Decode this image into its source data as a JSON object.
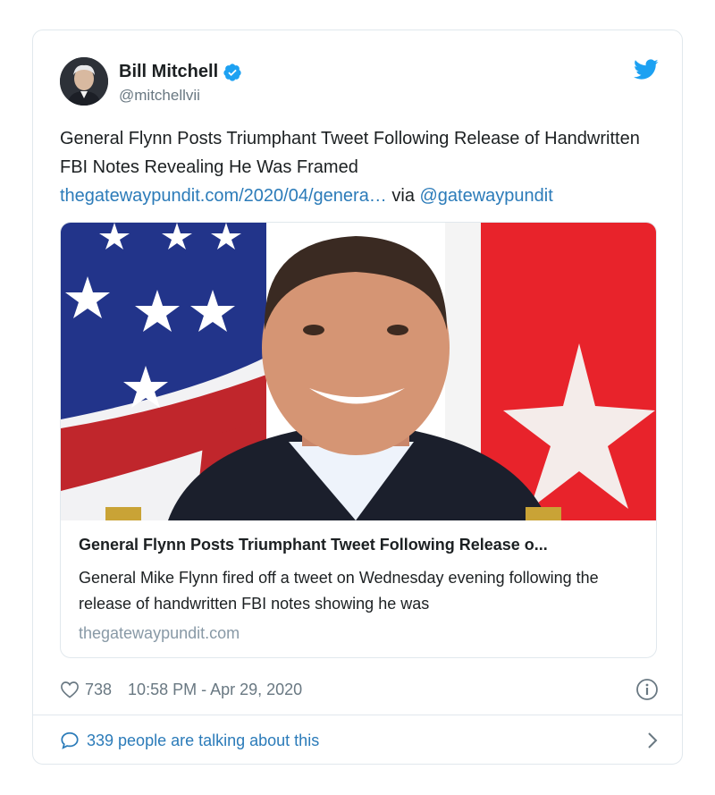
{
  "author": {
    "name": "Bill Mitchell",
    "handle": "@mitchellvii"
  },
  "tweet": {
    "text_line": "General Flynn Posts Triumphant Tweet Following Release of Handwritten FBI Notes Revealing He Was Framed",
    "link": "thegatewaypundit.com/2020/04/genera…",
    "via": " via ",
    "mention": "@gatewaypundit"
  },
  "card": {
    "title": "General Flynn Posts Triumphant Tweet Following Release o...",
    "description": "General Mike Flynn fired off a tweet on Wednesday evening following the release of handwritten FBI notes showing he was",
    "domain": "thegatewaypundit.com"
  },
  "meta": {
    "likes": "738",
    "timestamp": "10:58 PM - Apr 29, 2020"
  },
  "footer": {
    "talking": "339 people are talking about this"
  },
  "colors": {
    "link": "#2b7bb9",
    "verified": "#1da1f2",
    "muted": "#697882"
  }
}
